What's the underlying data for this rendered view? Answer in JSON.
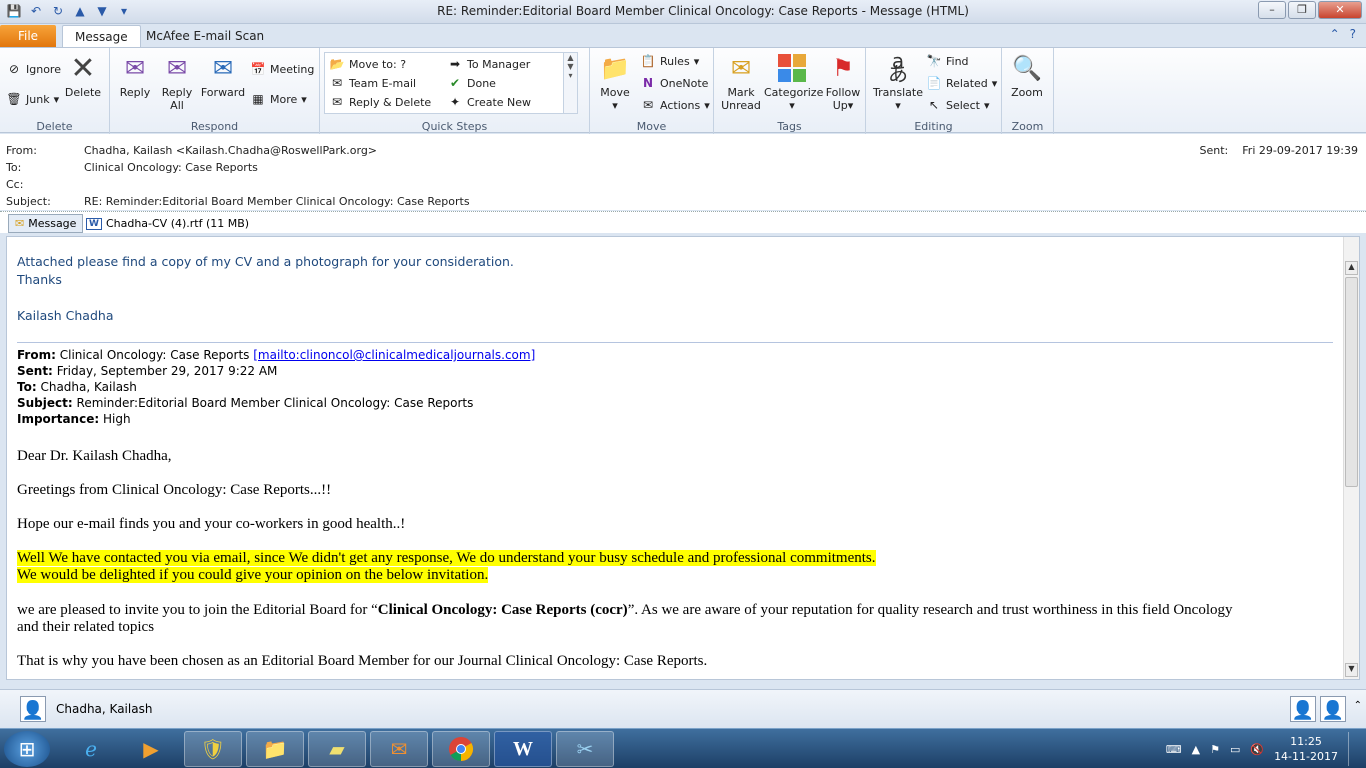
{
  "window": {
    "title": "RE: Reminder:Editorial Board Member Clinical Oncology: Case Reports  -  Message (HTML)"
  },
  "tabs": {
    "file": "File",
    "message": "Message",
    "mcafee": "McAfee E-mail Scan"
  },
  "ribbon": {
    "delete_group": {
      "label": "Delete",
      "ignore": "Ignore",
      "junk": "Junk",
      "delete": "Delete"
    },
    "respond_group": {
      "label": "Respond",
      "reply": "Reply",
      "reply_all_1": "Reply",
      "reply_all_2": "All",
      "forward": "Forward",
      "meeting": "Meeting",
      "more": "More"
    },
    "quicksteps_group": {
      "label": "Quick Steps",
      "items": [
        "Move to: ?",
        "Team E-mail",
        "Reply & Delete",
        "To Manager",
        "Done",
        "Create New"
      ]
    },
    "move_group": {
      "label": "Move",
      "move": "Move",
      "rules": "Rules",
      "onenote": "OneNote",
      "actions": "Actions"
    },
    "tags_group": {
      "label": "Tags",
      "mark_unread_1": "Mark",
      "mark_unread_2": "Unread",
      "categorize": "Categorize",
      "follow_up_1": "Follow",
      "follow_up_2": "Up"
    },
    "editing_group": {
      "label": "Editing",
      "translate": "Translate",
      "find": "Find",
      "related": "Related",
      "select": "Select"
    },
    "zoom_group": {
      "label": "Zoom",
      "zoom": "Zoom"
    }
  },
  "header": {
    "from_label": "From:",
    "from": "Chadha, Kailash <Kailash.Chadha@RoswellPark.org>",
    "to_label": "To:",
    "to": "Clinical Oncology: Case Reports",
    "cc_label": "Cc:",
    "cc": "",
    "subject_label": "Subject:",
    "subject": "RE: Reminder:Editorial Board Member Clinical Oncology: Case Reports",
    "sent_label": "Sent:",
    "sent": "Fri 29-09-2017 19:39"
  },
  "attachments": {
    "message_tab": "Message",
    "file": "Chadha-CV (4).rtf (11 MB)"
  },
  "body": {
    "reply_1": "Attached please find a copy of my CV and a photograph for your consideration.",
    "reply_2": "Thanks",
    "reply_sig": "Kailash Chadha",
    "fwd_from_label": "From:",
    "fwd_from": "Clinical Oncology: Case Reports ",
    "fwd_from_link": "[mailto:clinoncol@clinicalmedicaljournals.com]",
    "fwd_sent_label": "Sent:",
    "fwd_sent": "Friday, September 29, 2017 9:22 AM",
    "fwd_to_label": "To:",
    "fwd_to": "Chadha, Kailash",
    "fwd_subject_label": "Subject:",
    "fwd_subject": "Reminder:Editorial Board Member Clinical Oncology: Case Reports",
    "fwd_importance_label": "Importance:",
    "fwd_importance": "High",
    "greeting": "Dear Dr. Kailash Chadha,",
    "p1": "Greetings from Clinical Oncology: Case Reports...!!",
    "p2": "Hope our e-mail finds you and your co-workers in good health..!",
    "hl1": "Well We have contacted you via email, since We didn't get any response, We do understand your busy schedule and professional commitments.",
    "hl2": "We would be delighted if you could give your opinion on the below invitation.",
    "p3_a": "we are pleased to invite you to join the Editorial Board for “",
    "p3_b": "Clinical Oncology: Case Reports (cocr)",
    "p3_c": "”. As we are aware of your reputation for quality research and trust worthiness in this field Oncology",
    "p3_d": "and their related topics",
    "p4": "That is why you have been chosen as an Editorial Board Member for our Journal Clinical Oncology: Case Reports."
  },
  "people_pane": {
    "name": "Chadha, Kailash"
  },
  "taskbar": {
    "time": "11:25",
    "date": "14-11-2017"
  },
  "colors": {
    "accent": "#e2760c",
    "ribbon": "#dbe5f1",
    "highlight": "#ffff00",
    "reply_text": "#1f497d"
  }
}
